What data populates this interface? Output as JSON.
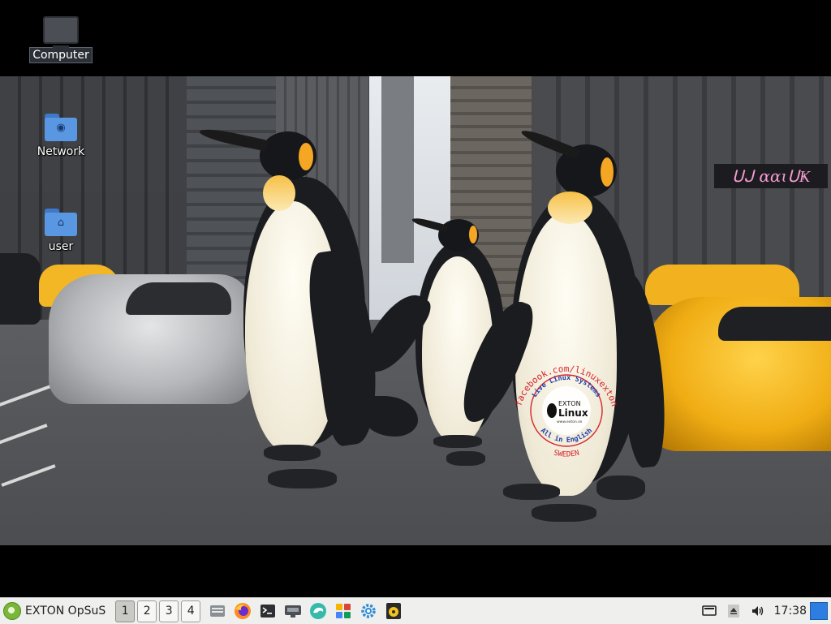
{
  "desktop": {
    "icons": [
      {
        "label": "Computer",
        "icon": "computer-icon"
      },
      {
        "label": "Network",
        "icon": "network-folder-icon"
      },
      {
        "label": "user",
        "icon": "home-folder-icon"
      }
    ]
  },
  "wallpaper": {
    "storefront_sign": "ᑌᒍ ɑɑɩᑌҜ",
    "stamp": {
      "outer_top": "facebook.com/linuxexton",
      "inner_top": "Live Linux Systems",
      "brand_line1": "EXTON",
      "brand_line2": "Linux",
      "brand_url": "www.exton.se",
      "inner_bottom": "All in English",
      "outer_bottom": "SWEDEN"
    }
  },
  "taskbar": {
    "menu_label": "EXTON OpSuS",
    "workspaces": [
      "1",
      "2",
      "3",
      "4"
    ],
    "active_workspace": "1",
    "launchers": [
      {
        "name": "file-manager-icon"
      },
      {
        "name": "firefox-icon"
      },
      {
        "name": "terminal-icon"
      },
      {
        "name": "network-manager-icon"
      },
      {
        "name": "opensuse-chameleon-icon"
      },
      {
        "name": "app-grid-icon"
      },
      {
        "name": "settings-gear-icon"
      },
      {
        "name": "media-player-icon"
      }
    ],
    "tray": [
      {
        "name": "keyboard-display-icon"
      },
      {
        "name": "eject-icon"
      },
      {
        "name": "volume-icon"
      }
    ],
    "clock": "17:38",
    "colors": {
      "accent": "#2e7de1",
      "menu_green": "#79b73a"
    }
  }
}
